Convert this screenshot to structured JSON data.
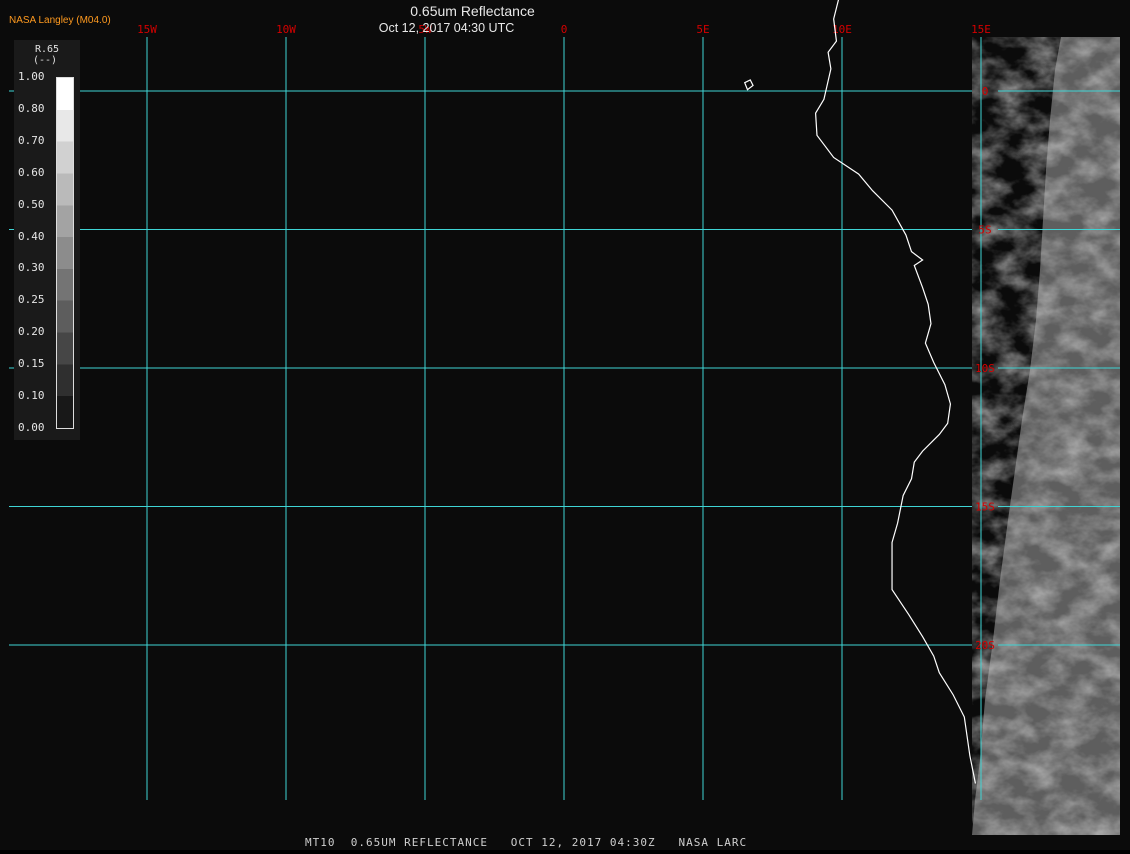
{
  "header": {
    "credit": "NASA Langley (M04.0)",
    "title": "0.65um Reflectance",
    "datetime": "Oct 12, 2017 04:30 UTC"
  },
  "footer": {
    "text": "MT10  0.65UM REFLECTANCE   OCT 12, 2017 04:30Z   NASA LARC"
  },
  "legend": {
    "variable": "R.65",
    "unit": "(--)",
    "scale_min": 0.0,
    "scale_max": 1.0,
    "tick_labels": [
      "1.00",
      "0.80",
      "0.70",
      "0.60",
      "0.50",
      "0.40",
      "0.30",
      "0.25",
      "0.20",
      "0.15",
      "0.10",
      "0.00"
    ]
  },
  "map": {
    "longitude_labels": [
      "15W",
      "10W",
      "5W",
      "0",
      "5E",
      "10E",
      "15E"
    ],
    "latitude_labels": [
      "0",
      "5S",
      "10S",
      "15S",
      "20S"
    ],
    "colors": {
      "grid": "#3fd4d4",
      "grid_labels": "#d40000",
      "coastline": "#ffffff",
      "background": "#0b0b0b"
    },
    "coastline_lonlat": [
      [
        9.9,
        3.4
      ],
      [
        9.7,
        2.6
      ],
      [
        9.8,
        1.8
      ],
      [
        9.5,
        1.4
      ],
      [
        9.6,
        0.8
      ],
      [
        9.35,
        -0.3
      ],
      [
        9.05,
        -0.8
      ],
      [
        9.1,
        -1.6
      ],
      [
        9.7,
        -2.4
      ],
      [
        10.6,
        -3.0
      ],
      [
        11.1,
        -3.6
      ],
      [
        11.8,
        -4.3
      ],
      [
        12.3,
        -5.2
      ],
      [
        12.5,
        -5.8
      ],
      [
        12.9,
        -6.1
      ],
      [
        12.6,
        -6.3
      ],
      [
        12.9,
        -7.1
      ],
      [
        13.1,
        -7.7
      ],
      [
        13.2,
        -8.4
      ],
      [
        13.0,
        -9.1
      ],
      [
        13.3,
        -9.8
      ],
      [
        13.7,
        -10.6
      ],
      [
        13.9,
        -11.3
      ],
      [
        13.8,
        -12.0
      ],
      [
        13.5,
        -12.4
      ],
      [
        12.9,
        -13.0
      ],
      [
        12.6,
        -13.4
      ],
      [
        12.5,
        -14.0
      ],
      [
        12.2,
        -14.6
      ],
      [
        12.0,
        -15.6
      ],
      [
        11.8,
        -16.3
      ],
      [
        11.8,
        -17.3
      ],
      [
        11.8,
        -18.0
      ],
      [
        12.4,
        -18.9
      ],
      [
        12.9,
        -19.7
      ],
      [
        13.3,
        -20.4
      ],
      [
        13.5,
        -21.0
      ],
      [
        14.0,
        -21.8
      ],
      [
        14.4,
        -22.6
      ],
      [
        14.5,
        -23.3
      ],
      [
        14.6,
        -24.0
      ],
      [
        14.8,
        -25.0
      ]
    ],
    "island_lonlat": [
      [
        6.5,
        0.3
      ],
      [
        6.7,
        0.4
      ],
      [
        6.8,
        0.2
      ],
      [
        6.6,
        0.05
      ]
    ]
  }
}
